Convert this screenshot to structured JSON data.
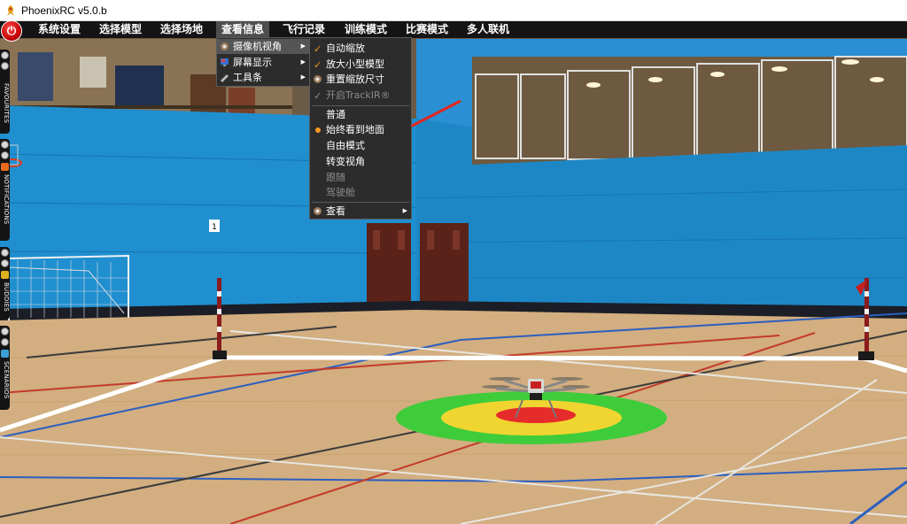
{
  "window": {
    "title": "PhoenixRC v5.0.b"
  },
  "menubar": {
    "items": [
      {
        "label": "系统设置"
      },
      {
        "label": "选择模型"
      },
      {
        "label": "选择场地"
      },
      {
        "label": "查看信息"
      },
      {
        "label": "飞行记录"
      },
      {
        "label": "训练模式"
      },
      {
        "label": "比赛模式"
      },
      {
        "label": "多人联机"
      }
    ],
    "active": "查看信息"
  },
  "view_menu": {
    "items": [
      {
        "label": "摄像机视角",
        "icon": "camera-icon",
        "submenu": true,
        "highlighted": true
      },
      {
        "label": "屏幕显示",
        "icon": "screen-icon",
        "submenu": true
      },
      {
        "label": "工具条",
        "icon": "toolbar-icon",
        "submenu": true
      }
    ]
  },
  "camera_menu": {
    "items": [
      {
        "label": "自动缩放",
        "mark": "check"
      },
      {
        "label": "放大小型模型",
        "mark": "check"
      },
      {
        "label": "重置缩放尺寸",
        "mark": "icon"
      },
      {
        "label": "开启TrackIR®",
        "mark": "check",
        "disabled": true
      },
      {
        "label": "普通"
      },
      {
        "label": "始终看到地面",
        "mark": "radio"
      },
      {
        "label": "自由模式"
      },
      {
        "label": "转变视角"
      },
      {
        "label": "跟随",
        "disabled": true
      },
      {
        "label": "驾驶舱",
        "disabled": true
      },
      {
        "label": "查看",
        "mark": "icon",
        "submenu": true
      }
    ]
  },
  "sidebar": {
    "tabs": [
      {
        "label": "FAVOURITES"
      },
      {
        "label": "NOTIFICATIONS"
      },
      {
        "label": "BUDDIES"
      },
      {
        "label": "SCENARIOS"
      }
    ]
  },
  "scene": {
    "marker_number": "1"
  },
  "colors": {
    "wall_blue": "#1f8fd0",
    "floor": "#d6b487",
    "menu_bg": "#2c2c2c",
    "accent_orange": "#f29a1f",
    "landing_green": "#3fcc3a",
    "landing_yellow": "#f0d531",
    "landing_red": "#e62b2b",
    "arrow_red": "#e8231c"
  }
}
